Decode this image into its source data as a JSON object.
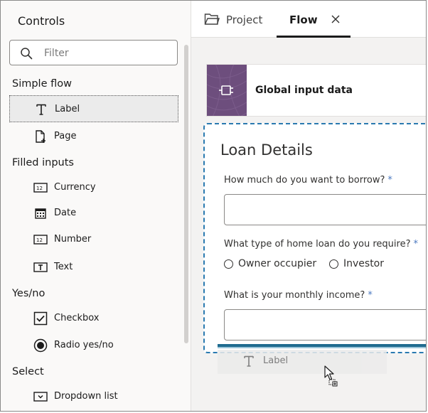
{
  "controls_panel": {
    "title": "Controls",
    "filter_placeholder": "Filter",
    "sections": [
      {
        "title": "Simple flow",
        "items": [
          {
            "label": "Label",
            "icon": "text-t-icon",
            "selected": true
          },
          {
            "label": "Page",
            "icon": "page-add-icon"
          }
        ]
      },
      {
        "title": "Filled inputs",
        "items": [
          {
            "label": "Currency",
            "icon": "number-field-icon"
          },
          {
            "label": "Date",
            "icon": "calendar-icon"
          },
          {
            "label": "Number",
            "icon": "number-field-icon"
          },
          {
            "label": "Text",
            "icon": "text-field-icon"
          }
        ]
      },
      {
        "title": "Yes/no",
        "items": [
          {
            "label": "Checkbox",
            "icon": "checkbox-icon"
          },
          {
            "label": "Radio yes/no",
            "icon": "radio-icon"
          }
        ]
      },
      {
        "title": "Select",
        "items": [
          {
            "label": "Dropdown list",
            "icon": "dropdown-icon"
          }
        ]
      }
    ]
  },
  "tabs": {
    "project_label": "Project",
    "flow_label": "Flow",
    "active": "Flow"
  },
  "canvas": {
    "global_input_title": "Global input data",
    "form": {
      "title": "Loan Details",
      "q1": "How much do you want to borrow?",
      "q2": "What type of home loan do you require?",
      "q2_options": [
        "Owner occupier",
        "Investor"
      ],
      "q3": "What is your monthly income?",
      "required_mark": "*"
    },
    "drag_ghost_label": "Label"
  },
  "colors": {
    "accent_dashed_border": "#2a7ab0",
    "drop_indicator": "#1f6b8f",
    "global_icon_bg": "#6d4e7d",
    "required_star": "#4a78c0"
  }
}
